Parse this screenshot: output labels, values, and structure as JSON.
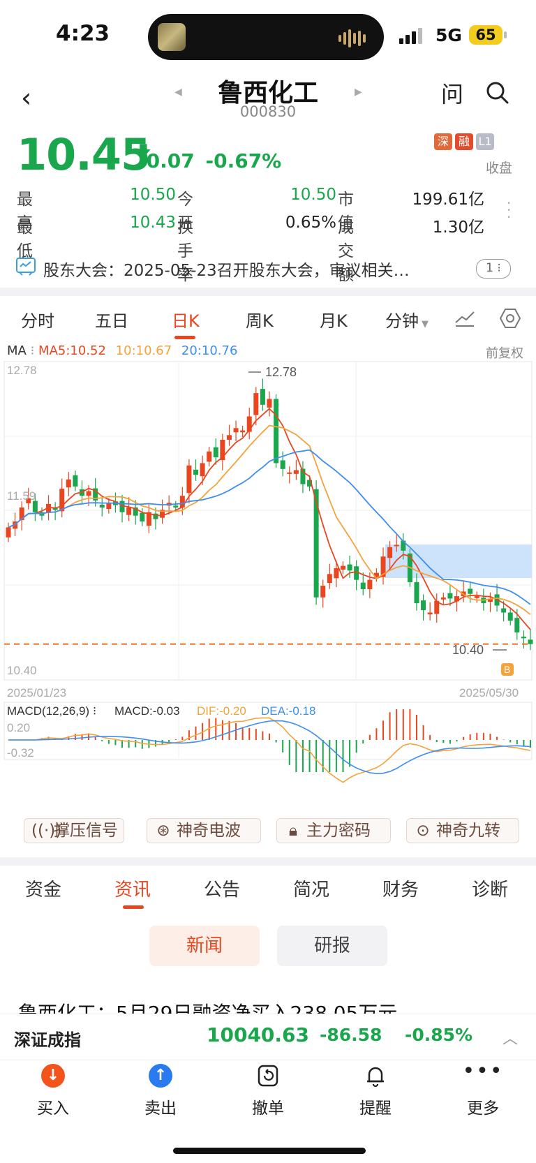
{
  "status": {
    "time": "4:23",
    "network": "5G",
    "battery": "65"
  },
  "nav": {
    "title": "鲁西化工",
    "code": "000830",
    "ask_label": "问"
  },
  "quote": {
    "price": "10.45",
    "change": "-0.07",
    "change_pct": "-0.67%",
    "badges": [
      {
        "text": "深",
        "color": "#e06a3a"
      },
      {
        "text": "融",
        "color": "#e24b2b"
      },
      {
        "text": "L1",
        "color": "#b9bcc6"
      }
    ],
    "market_state": "收盘",
    "stats": [
      {
        "label": "最　高",
        "value": "10.50",
        "color": "#1aa64c"
      },
      {
        "label": "今　开",
        "value": "10.50",
        "color": "#1aa64c"
      },
      {
        "label": "市　值",
        "value": "199.61亿",
        "color": "#222"
      },
      {
        "label": "最　低",
        "value": "10.43",
        "color": "#1aa64c"
      },
      {
        "label": "换手率",
        "value": "0.65%",
        "color": "#222"
      },
      {
        "label": "成交额",
        "value": "1.30亿",
        "color": "#222"
      }
    ]
  },
  "notice": {
    "text": "股东大会：2025-05-23召开股东大会，审议相关…",
    "count": "1"
  },
  "chart_tabs": [
    "分时",
    "五日",
    "日K",
    "周K",
    "月K",
    "分钟"
  ],
  "chart_tabs_active": "日K",
  "ma_legend": {
    "title": "MA",
    "ma5": "MA5:10.52",
    "ma10": "10:10.67",
    "ma20": "20:10.76",
    "adjust": "前复权"
  },
  "chart_labels": {
    "ymax": "12.78",
    "ymid": "11.59",
    "ymin": "10.40",
    "start_date": "2025/01/23",
    "end_date": "2025/05/30",
    "high_mark": "12.78",
    "low_mark": "10.40",
    "b_marker": "B"
  },
  "macd_legend": {
    "title": "MACD(12,26,9)",
    "macd": "MACD:-0.03",
    "dif": "DIF:-0.20",
    "dea": "DEA:-0.18",
    "ymax": "0.20",
    "ymin": "-0.32"
  },
  "tools": [
    "撑压信号",
    "神奇电波",
    "主力密码",
    "神奇九转"
  ],
  "bottom_tabs": [
    "资金",
    "资讯",
    "公告",
    "简况",
    "财务",
    "诊断"
  ],
  "bottom_tabs_active": "资讯",
  "sub_tabs": {
    "news": "新闻",
    "report": "研报"
  },
  "headline": "鲁西化工：5月29日融资净买入238.05万元",
  "ticker": {
    "name": "深证成指",
    "value": "10040.63",
    "change": "-86.58",
    "change_pct": "-0.85%"
  },
  "actions": [
    {
      "label": "买入",
      "icon": "↓",
      "color": "#f2541b"
    },
    {
      "label": "卖出",
      "icon": "↑",
      "color": "#2b7bf0"
    },
    {
      "label": "撤单",
      "icon": "",
      "color": ""
    },
    {
      "label": "提醒",
      "icon": "",
      "color": ""
    },
    {
      "label": "更多",
      "icon": "",
      "color": ""
    }
  ],
  "colors": {
    "down": "#1aa64c",
    "up": "#e9461f",
    "ma5": "#e9461f",
    "ma10": "#f4a23a",
    "ma20": "#3d8ef0",
    "accent": "#e9461f"
  },
  "chart_data": {
    "type": "candlestick",
    "x_start": "2025/01/23",
    "x_end": "2025/05/30",
    "ylim": [
      10.4,
      12.78
    ],
    "high": 12.78,
    "low": 10.4,
    "close": [
      11.45,
      11.5,
      11.62,
      11.7,
      11.58,
      11.55,
      11.65,
      11.6,
      11.78,
      11.86,
      11.8,
      11.72,
      11.76,
      11.68,
      11.62,
      11.66,
      11.64,
      11.58,
      11.62,
      11.55,
      11.5,
      11.58,
      11.52,
      11.6,
      11.66,
      11.62,
      11.72,
      11.98,
      11.9,
      12.0,
      12.1,
      12.05,
      12.2,
      12.24,
      12.3,
      12.28,
      12.4,
      12.6,
      12.5,
      12.55,
      12.0,
      11.95,
      11.92,
      11.94,
      11.82,
      11.8,
      10.85,
      10.95,
      11.05,
      11.1,
      11.12,
      11.08,
      11.0,
      10.92,
      11.0,
      11.06,
      11.2,
      11.28,
      11.3,
      11.25,
      10.98,
      10.8,
      10.74,
      10.72,
      10.82,
      10.85,
      10.84,
      10.86,
      10.9,
      10.88,
      10.86,
      10.8,
      10.84,
      10.78,
      10.72,
      10.65,
      10.55,
      10.5,
      10.45
    ],
    "ma5_last": 10.52,
    "ma10_last": 10.67,
    "ma20_last": 10.76,
    "macd": {
      "dif_last": -0.2,
      "dea_last": -0.18,
      "macd_last": -0.03,
      "ylim": [
        -0.32,
        0.2
      ]
    }
  }
}
